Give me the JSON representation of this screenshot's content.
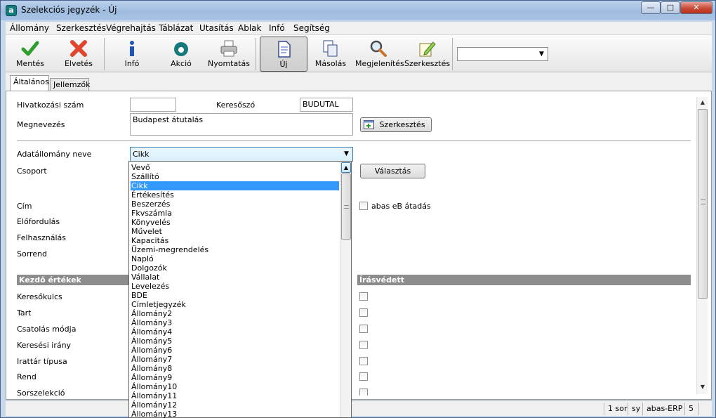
{
  "window": {
    "title": "Szelekciós jegyzék - Új",
    "app_icon": "abas-logo-icon"
  },
  "menu": [
    "Állomány",
    "Szerkesztés",
    "Végrehajtás",
    "Táblázat",
    "Utasítás",
    "Ablak",
    "Infó",
    "Segítség"
  ],
  "toolbar": {
    "buttons": [
      {
        "label": "Mentés",
        "icon": "checkmark-icon"
      },
      {
        "label": "Elvetés",
        "icon": "x-icon"
      },
      {
        "label": "Infó",
        "icon": "info-icon"
      },
      {
        "label": "Akció",
        "icon": "action-icon"
      },
      {
        "label": "Nyomtatás",
        "icon": "printer-icon"
      },
      {
        "label": "Új",
        "icon": "new-document-icon"
      },
      {
        "label": "Másolás",
        "icon": "copy-icon"
      },
      {
        "label": "Megjelenítés",
        "icon": "magnifier-icon"
      },
      {
        "label": "Szerkesztés",
        "icon": "edit-icon"
      }
    ],
    "combo_value": ""
  },
  "tabs": [
    {
      "label": "Általános",
      "active": true
    },
    {
      "label": "Jellemzők",
      "active": false
    }
  ],
  "form": {
    "ref_label": "Hivatkozási szám",
    "ref_value": "",
    "keyword_label": "Keresőszó",
    "keyword_value": "BUDUTAL",
    "name_label": "Megnevezés",
    "name_value": "Budapest átutalás",
    "edit_button": "Szerkesztés",
    "dataset_label": "Adatállomány neve",
    "dataset_value": "Cikk",
    "group_label": "Csoport",
    "choose_button": "Választás",
    "address_label": "Cím",
    "abas_checkbox_label": "abas eB átadás",
    "occurrence_label": "Előfordulás",
    "usage_label": "Felhasználás",
    "order_label": "Sorrend",
    "start_values_header": "Kezdő értékek",
    "readonly_header": "Írásvédett",
    "rows": [
      "Keresőkulcs",
      "Tart",
      "Csatolás módja",
      "Keresési irány",
      "Irattár típusa",
      "Rend",
      "Sorszelekció"
    ]
  },
  "dropdown": {
    "selected": "Cikk",
    "items": [
      "Vevő",
      "Szállító",
      "Cikk",
      "Értékesítés",
      "Beszerzés",
      "Fkvszámla",
      "Könyvelés",
      "Művelet",
      "Kapacitás",
      "Üzemi-megrendelés",
      "Napló",
      "Dolgozók",
      "Vállalat",
      "Levelezés",
      "BDE",
      "Címletjegyzék",
      "Állomány2",
      "Állomány3",
      "Állomány4",
      "Állomány5",
      "Állomány6",
      "Állomány7",
      "Állomány8",
      "Állomány9",
      "Állomány10",
      "Állomány11",
      "Állomány12",
      "Állomány13"
    ]
  },
  "status": {
    "rows": "1 sor",
    "user": "sy",
    "app": "abas-ERP",
    "num": "5"
  }
}
